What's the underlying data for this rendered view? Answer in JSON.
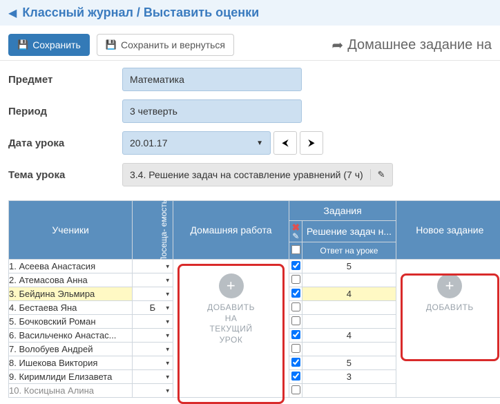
{
  "breadcrumb": {
    "back_icon": "◀",
    "path": "Классный журнал / Выставить оценки"
  },
  "toolbar": {
    "save_icon": "💾",
    "save_label": "Сохранить",
    "save_back_icon": "💾",
    "save_back_label": "Сохранить и вернуться",
    "hw_icon": "➦",
    "hw_label": "Домашнее задание на"
  },
  "form": {
    "subject_label": "Предмет",
    "subject_value": "Математика",
    "period_label": "Период",
    "period_value": "3 четверть",
    "date_label": "Дата урока",
    "date_value": "20.01.17",
    "topic_label": "Тема урока",
    "topic_value": "3.4. Решение задач на составление уравнений (7 ч)"
  },
  "grid": {
    "students_header": "Ученики",
    "attend_header": "Посеща-\nемость",
    "homework_header": "Домашняя работа",
    "tasks_header": "Задания",
    "task_col": "Решение задач н...",
    "answer_sub": "Ответ на уроке",
    "new_task_header": "Новое задание",
    "add_current": "ДОБАВИТЬ\nНА\nТЕКУЩИЙ\nУРОК",
    "add_label": "ДОБАВИТЬ"
  },
  "students": [
    {
      "n": "1. Асеева Анастасия",
      "att": "",
      "chk": true,
      "grade": "5",
      "hi": false
    },
    {
      "n": "2. Атемасова Анна",
      "att": "",
      "chk": false,
      "grade": "",
      "hi": false
    },
    {
      "n": "3. Бейдина Эльмира",
      "att": "",
      "chk": true,
      "grade": "4",
      "hi": true
    },
    {
      "n": "4. Бестаева Яна",
      "att": "Б",
      "chk": false,
      "grade": "",
      "hi": false
    },
    {
      "n": "5. Бочковский Роман",
      "att": "",
      "chk": false,
      "grade": "",
      "hi": false
    },
    {
      "n": "6. Васильченко Анастас...",
      "att": "",
      "chk": true,
      "grade": "4",
      "hi": false
    },
    {
      "n": "7. Волобуев Андрей",
      "att": "",
      "chk": false,
      "grade": "",
      "hi": false
    },
    {
      "n": "8. Ишекова Виктория",
      "att": "",
      "chk": true,
      "grade": "5",
      "hi": false
    },
    {
      "n": "9. Киримлиди Елизавета",
      "att": "",
      "chk": true,
      "grade": "3",
      "hi": false
    },
    {
      "n": "10. Косицына Алина",
      "att": "",
      "chk": false,
      "grade": "",
      "hi": false
    }
  ]
}
